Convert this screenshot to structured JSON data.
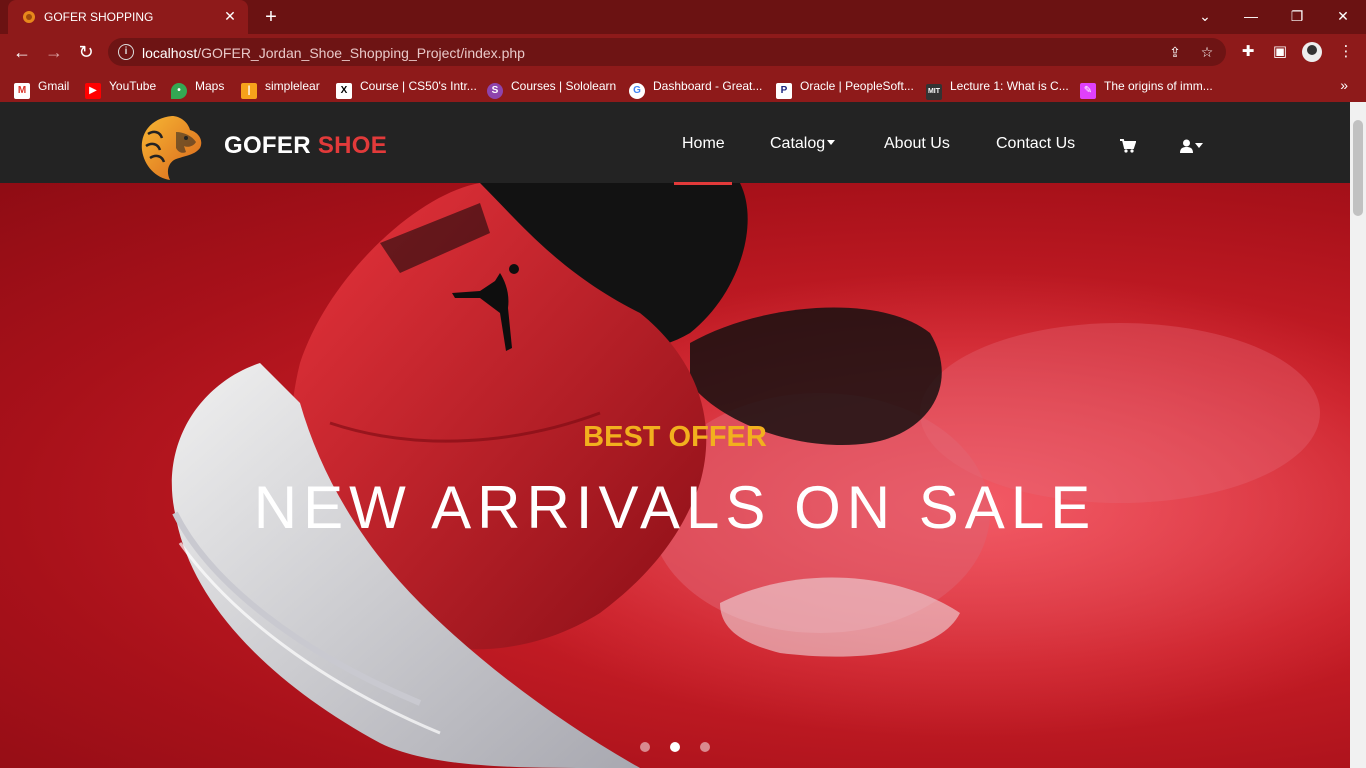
{
  "browser": {
    "tab_title": "GOFER SHOPPING",
    "url_host": "localhost",
    "url_path": "/GOFER_Jordan_Shoe_Shopping_Project/index.php",
    "bookmarks": [
      {
        "label": "Gmail",
        "icon": "gmail-icon"
      },
      {
        "label": "YouTube",
        "icon": "youtube-icon"
      },
      {
        "label": "Maps",
        "icon": "maps-icon"
      },
      {
        "label": "simplelear",
        "icon": "simplilearn-icon"
      },
      {
        "label": "Course | CS50's Intr...",
        "icon": "edx-icon"
      },
      {
        "label": "Courses | Sololearn",
        "icon": "sololearn-icon"
      },
      {
        "label": "Dashboard - Great...",
        "icon": "google-icon"
      },
      {
        "label": "Oracle | PeopleSoft...",
        "icon": "peoplesoft-icon"
      },
      {
        "label": "Lecture 1: What is C...",
        "icon": "mit-ocw-icon"
      },
      {
        "label": "The origins of imm...",
        "icon": "article-icon"
      }
    ]
  },
  "site": {
    "brand_main": "GOFER",
    "brand_accent": "SHOE",
    "nav": {
      "home": "Home",
      "catalog": "Catalog",
      "about": "About Us",
      "contact": "Contact Us"
    }
  },
  "hero": {
    "kicker": "BEST OFFER",
    "title": "NEW ARRIVALS ON SALE",
    "slides_total": 3,
    "active_slide": 2
  },
  "colors": {
    "chrome": "#8e1a1a",
    "navbar": "#232323",
    "accent_red": "#e23a3a",
    "kicker_gold": "#f2b01e"
  }
}
